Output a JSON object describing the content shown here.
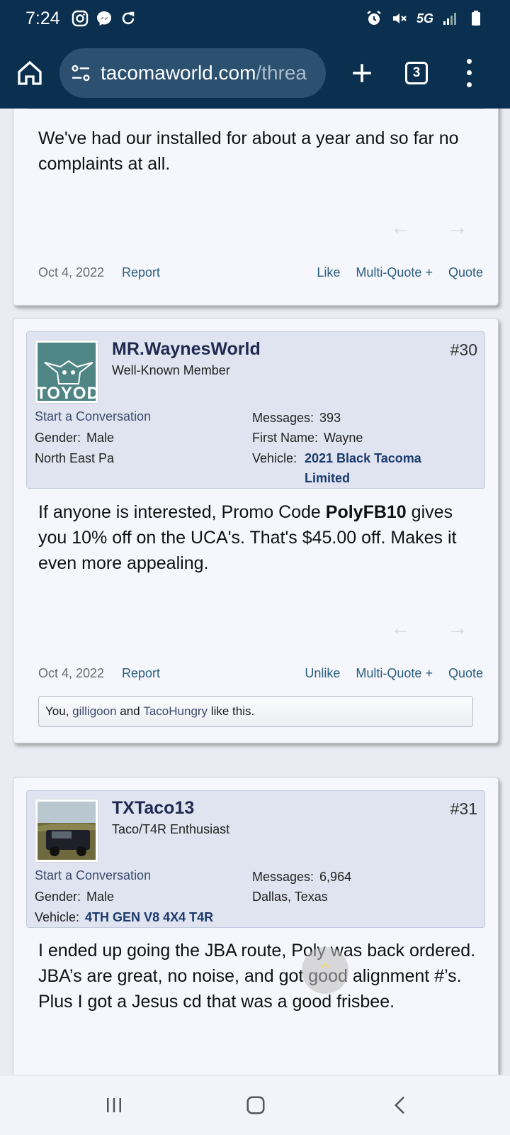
{
  "status": {
    "time": "7:24",
    "network": "5G",
    "icons": [
      "instagram-icon",
      "messenger-icon",
      "sync-icon",
      "alarm-icon",
      "mute-icon",
      "signal-icon",
      "battery-icon"
    ]
  },
  "browser": {
    "url_host": "tacomaworld.com",
    "url_rest": "/threa",
    "tab_count": "3"
  },
  "post_prev": {
    "body": "We've had our installed for about a year and so far no complaints at all.",
    "date": "Oct 4, 2022",
    "report": "Report",
    "like": "Like",
    "multiquote": "Multi-Quote +",
    "quote": "Quote"
  },
  "post30": {
    "username": "MR.WaynesWorld",
    "title": "Well-Known Member",
    "number": "#30",
    "avatar_text": "TOYODA",
    "conversation": "Start a Conversation",
    "gender_label": "Gender:",
    "gender": "Male",
    "location": "North East Pa",
    "messages_label": "Messages:",
    "messages": "393",
    "firstname_label": "First Name:",
    "firstname": "Wayne",
    "vehicle_label": "Vehicle:",
    "vehicle_line1": "2021 Black Tacoma",
    "vehicle_line2": "Limited",
    "body_pre": "If anyone is interested, Promo Code ",
    "body_code": "PolyFB10",
    "body_post": " gives you 10% off on the UCA's. That's $45.00 off. Makes it even more appealing.",
    "date": "Oct 4, 2022",
    "report": "Report",
    "unlike": "Unlike",
    "multiquote": "Multi-Quote +",
    "quote": "Quote",
    "likes_you": "You, ",
    "likes_user1": "gilligoon",
    "likes_and": " and ",
    "likes_user2": "TacoHungry",
    "likes_tail": " like this."
  },
  "post31": {
    "username": "TXTaco13",
    "title": "Taco/T4R Enthusiast",
    "number": "#31",
    "conversation": "Start a Conversation",
    "gender_label": "Gender:",
    "gender": "Male",
    "vehicle_label": "Vehicle:",
    "vehicle": "4TH GEN V8 4X4 T4R",
    "messages_label": "Messages:",
    "messages": "6,964",
    "location": "Dallas, Texas",
    "body": "I ended up going the JBA route, Poly was back ordered. JBA’s are great, no noise, and got good alignment #’s. Plus I got a Jesus cd that was a good frisbee."
  },
  "colors": {
    "header": "#0b2f4e",
    "post_bg": "#f6f7fc",
    "userbox_bg": "#e0e4f1",
    "link": "#2a5d7d"
  }
}
